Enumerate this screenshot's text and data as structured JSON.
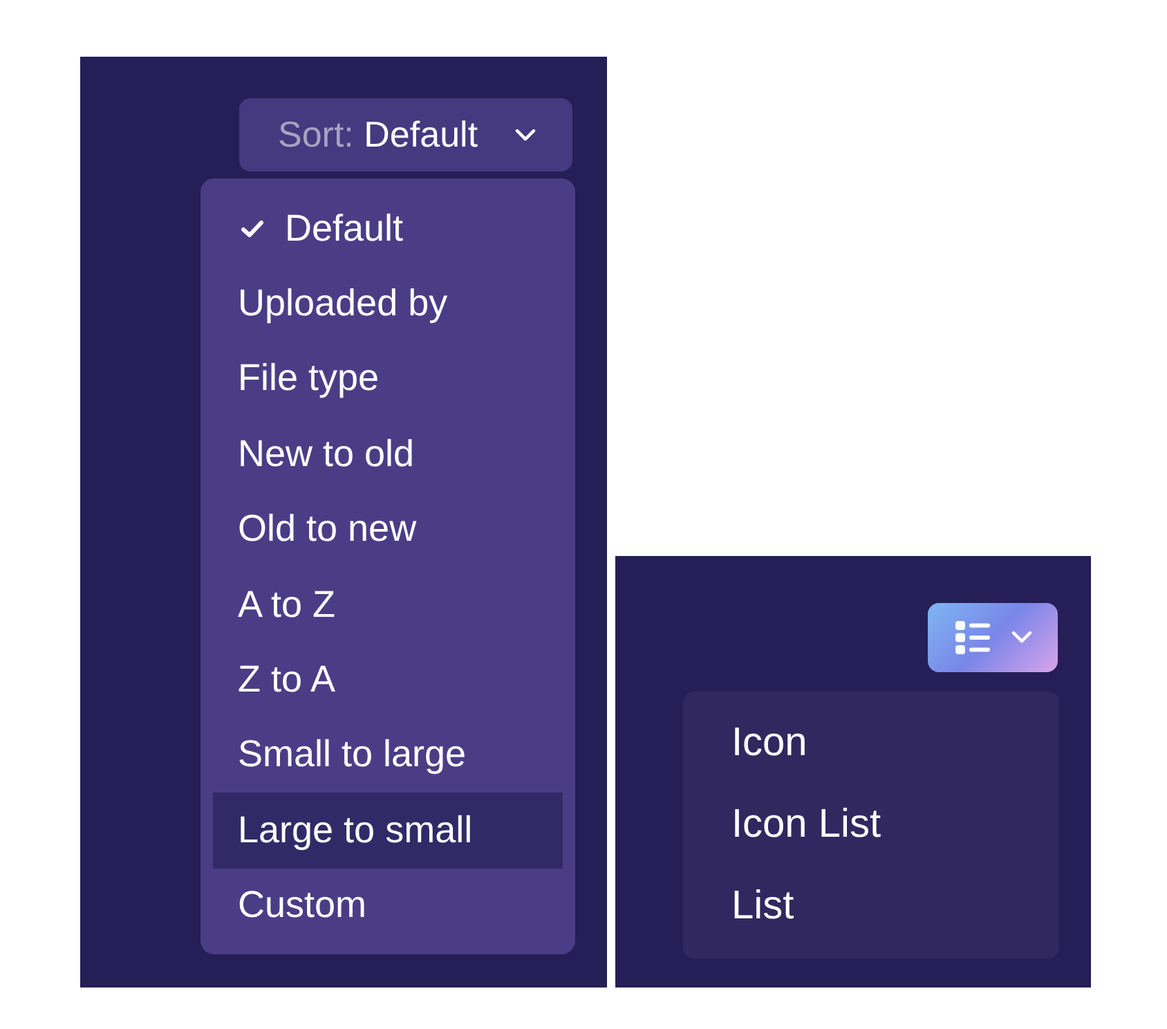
{
  "sort_dropdown": {
    "label": "Sort:",
    "value": "Default",
    "expanded": true,
    "options": [
      {
        "label": "Default",
        "selected": true,
        "hovered": false
      },
      {
        "label": "Uploaded by",
        "selected": false,
        "hovered": false
      },
      {
        "label": "File type",
        "selected": false,
        "hovered": false
      },
      {
        "label": "New to old",
        "selected": false,
        "hovered": false
      },
      {
        "label": "Old to new",
        "selected": false,
        "hovered": false
      },
      {
        "label": "A to Z",
        "selected": false,
        "hovered": false
      },
      {
        "label": "Z to A",
        "selected": false,
        "hovered": false
      },
      {
        "label": "Small to large",
        "selected": false,
        "hovered": false
      },
      {
        "label": "Large to small",
        "selected": false,
        "hovered": true
      },
      {
        "label": "Custom",
        "selected": false,
        "hovered": false
      }
    ]
  },
  "view_dropdown": {
    "expanded": true,
    "options": [
      {
        "label": "Icon"
      },
      {
        "label": "Icon List"
      },
      {
        "label": "List"
      }
    ]
  }
}
